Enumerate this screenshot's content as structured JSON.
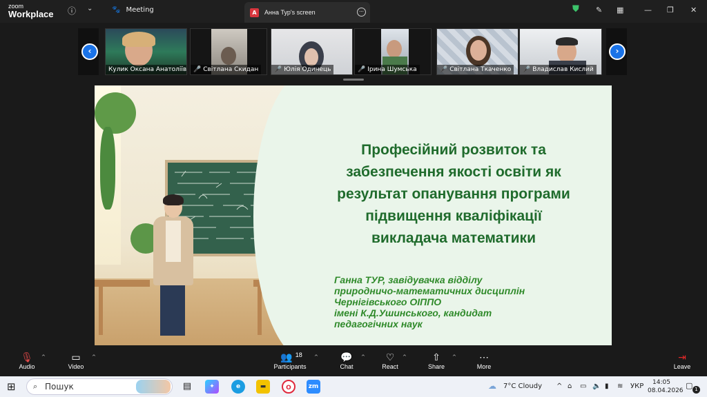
{
  "app": {
    "logo_line1": "zoom",
    "logo_line2": "Workplace"
  },
  "header": {
    "meeting_label": "Meeting",
    "tab_badge": "A",
    "tab_title": "Анна Тур's screen"
  },
  "participants": [
    {
      "name": "Кулик Оксана Анатоліїв...",
      "muted": false
    },
    {
      "name": "Світлана Скидан",
      "muted": true
    },
    {
      "name": "Юлія Одинець",
      "muted": true
    },
    {
      "name": "Ірина Шумська",
      "muted": true
    },
    {
      "name": "Світлана Ткаченко",
      "muted": true
    },
    {
      "name": "Владислав Кислий",
      "muted": true
    }
  ],
  "slide": {
    "title_lines": [
      "Професійний розвиток та",
      "забезпечення якості освіти як",
      "результат опанування програми",
      "підвищення кваліфікації",
      "викладача математики"
    ],
    "author_lines": [
      "Ганна ТУР, завідувачка відділу",
      "природничо-математичних дисциплін",
      "Чернігівського ОІППО",
      "імені К.Д.Ушинського, кандидат",
      "педагогічних наук"
    ]
  },
  "toolbar": {
    "audio": "Audio",
    "video": "Video",
    "participants": "Participants",
    "participants_count": "18",
    "chat": "Chat",
    "react": "React",
    "share": "Share",
    "more": "More",
    "leave": "Leave"
  },
  "taskbar": {
    "search_placeholder": "Пошук",
    "weather": "7°C  Cloudy",
    "language": "УКР",
    "time": "14:05",
    "date": "08.04.2026",
    "notifications": "1"
  },
  "colors": {
    "accent": "#1a73e8",
    "leave": "#e02828",
    "slide_title": "#1f6b2c",
    "slide_author": "#2f8a2a"
  }
}
